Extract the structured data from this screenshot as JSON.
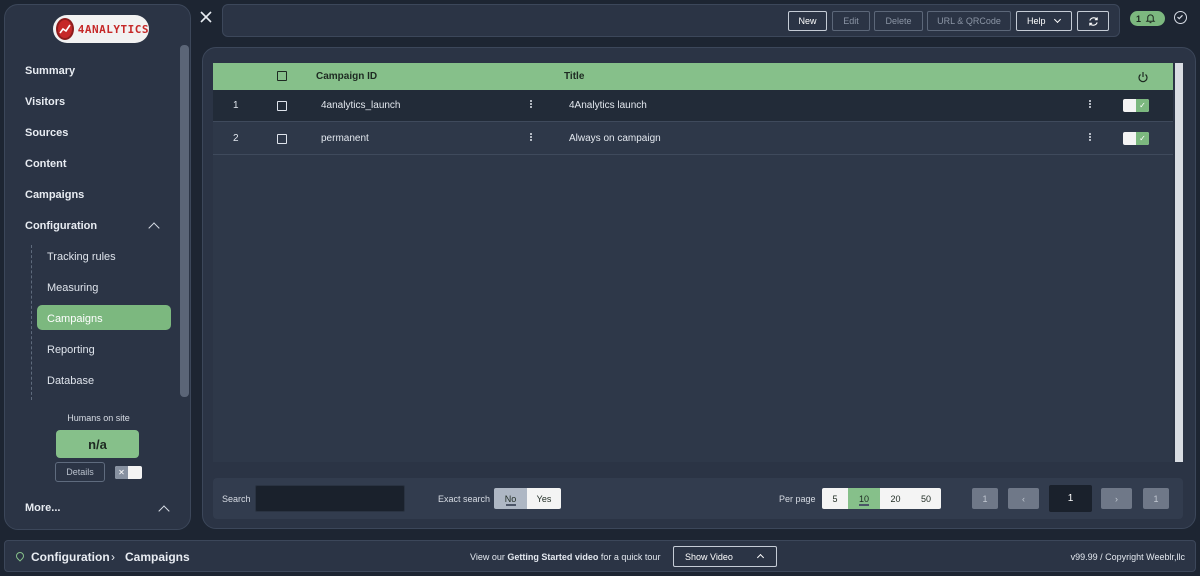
{
  "brand": {
    "logo_text": "4ANALYTICS"
  },
  "sidebar": {
    "items": [
      {
        "label": "Summary"
      },
      {
        "label": "Visitors"
      },
      {
        "label": "Sources"
      },
      {
        "label": "Content"
      },
      {
        "label": "Campaigns"
      },
      {
        "label": "Configuration"
      }
    ],
    "sub_items": [
      {
        "label": "Tracking rules"
      },
      {
        "label": "Measuring"
      },
      {
        "label": "Campaigns",
        "active": true
      },
      {
        "label": "Reporting"
      },
      {
        "label": "Database"
      }
    ],
    "humans_label": "Humans on site",
    "humans_value": "n/a",
    "details_label": "Details",
    "toggle_off_glyph": "✕",
    "more_label": "More..."
  },
  "toolbar": {
    "new_label": "New",
    "edit_label": "Edit",
    "delete_label": "Delete",
    "url_label": "URL & QRCode",
    "help_label": "Help",
    "notification_count": "1"
  },
  "table": {
    "columns": {
      "campaign_id": "Campaign ID",
      "title": "Title"
    },
    "rows": [
      {
        "num": "1",
        "campaign_id": "4analytics_launch",
        "title": "4Analytics launch",
        "enabled": true
      },
      {
        "num": "2",
        "campaign_id": "permanent",
        "title": "Always on campaign",
        "enabled": true
      }
    ],
    "toggle_on_glyph": "✓"
  },
  "search": {
    "label": "Search",
    "value": "",
    "exact_label": "Exact search",
    "exact_no": "No",
    "exact_yes": "Yes",
    "exact_selected": "No",
    "per_page_label": "Per page",
    "per_page_options": [
      "5",
      "10",
      "20",
      "50"
    ],
    "per_page_selected": "10"
  },
  "pagination": {
    "first": "1",
    "prev": "‹",
    "current": "1",
    "next": "›",
    "last": "1"
  },
  "footer": {
    "crumb_1": "Configuration",
    "crumb_sep": "›",
    "crumb_2": "Campaigns",
    "promo_pre": "View our",
    "promo_bold": "Getting Started video",
    "promo_post": "for a quick tour",
    "show_video": "Show Video",
    "version": "v99.99",
    "copyright": "Copyright Weeblr,llc"
  },
  "colors": {
    "accent_green": "#86c08a",
    "background": "#1d2532",
    "panel": "#2b3445"
  }
}
